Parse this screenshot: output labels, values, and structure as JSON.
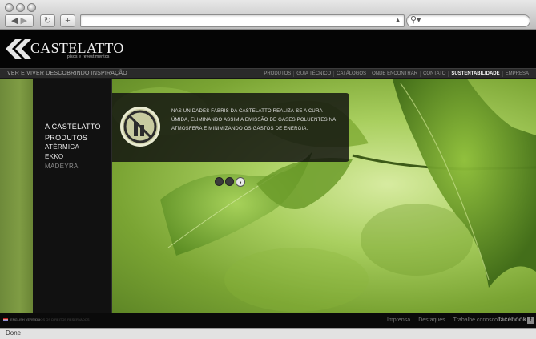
{
  "browser": {
    "url_value": "",
    "search_value": "",
    "status_text": "Done"
  },
  "brand": {
    "name": "CASTELATTO",
    "subtitle": "pisos e revestimentos"
  },
  "menubar": {
    "tagline": "Ver e viver descobrindo inspiração",
    "items": [
      {
        "label": "Produtos",
        "active": false
      },
      {
        "label": "Guia Técnico",
        "active": false
      },
      {
        "label": "Catálogos",
        "active": false
      },
      {
        "label": "Onde encontrar",
        "active": false
      },
      {
        "label": "Contato",
        "active": false
      },
      {
        "label": "Sustentabilidade",
        "active": true
      },
      {
        "label": "Empresa",
        "active": false
      }
    ]
  },
  "sidebar": {
    "items": [
      {
        "label": "A Castelatto"
      },
      {
        "label": "Produtos"
      },
      {
        "label": "Atérmica"
      },
      {
        "label": "Ekko"
      },
      {
        "label": "Madeyra"
      }
    ]
  },
  "infobox": {
    "text": "Nas unidades fabris da Castelatto realiza-se a cura úmida, eliminando assim a emissão de gases poluentes na atmosfera e minimizando os gastos de energia.",
    "icon": "no-smokestack-icon",
    "slides_total": 3,
    "slide_active": 3
  },
  "footer": {
    "language": "English version",
    "copyright": "Todos os direitos reservados",
    "links": [
      "Imprensa",
      "Destaques",
      "Trabalhe conosco"
    ],
    "facebook": "facebook"
  },
  "colors": {
    "page_bg": "#050505",
    "accent_green": "#7fa43a"
  }
}
